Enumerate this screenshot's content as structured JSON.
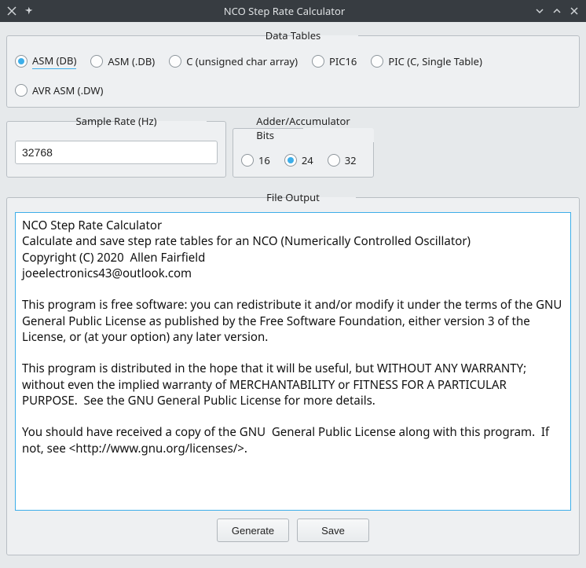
{
  "window": {
    "title": "NCO Step Rate Calculator"
  },
  "data_tables": {
    "legend": "Data Tables",
    "options": [
      "ASM (DB)",
      "ASM (.DB)",
      "C (unsigned char array)",
      "PIC16",
      "PIC (C, Single Table)",
      "AVR ASM (.DW)"
    ],
    "selected_index": 0
  },
  "sample_rate": {
    "legend": "Sample Rate (Hz)",
    "value": "32768"
  },
  "accum_bits": {
    "legend": "Adder/Accumulator Bits",
    "options": [
      "16",
      "24",
      "32"
    ],
    "selected_index": 1
  },
  "file_output": {
    "legend": "File Output",
    "text": "NCO Step Rate Calculator\nCalculate and save step rate tables for an NCO (Numerically Controlled Oscillator)\nCopyright (C) 2020  Allen Fairfield\njoeelectronics43@outlook.com\n\nThis program is free software: you can redistribute it and/or modify it under the terms of the GNU General Public License as published by the Free Software Foundation, either version 3 of the License, or (at your option) any later version.\n\nThis program is distributed in the hope that it will be useful, but WITHOUT ANY WARRANTY; without even the implied warranty of MERCHANTABILITY or FITNESS FOR A PARTICULAR PURPOSE.  See the GNU General Public License for more details.\n\nYou should have received a copy of the GNU  General Public License along with this program.  If not, see <http://www.gnu.org/licenses/>."
  },
  "buttons": {
    "generate": "Generate",
    "save": "Save"
  }
}
